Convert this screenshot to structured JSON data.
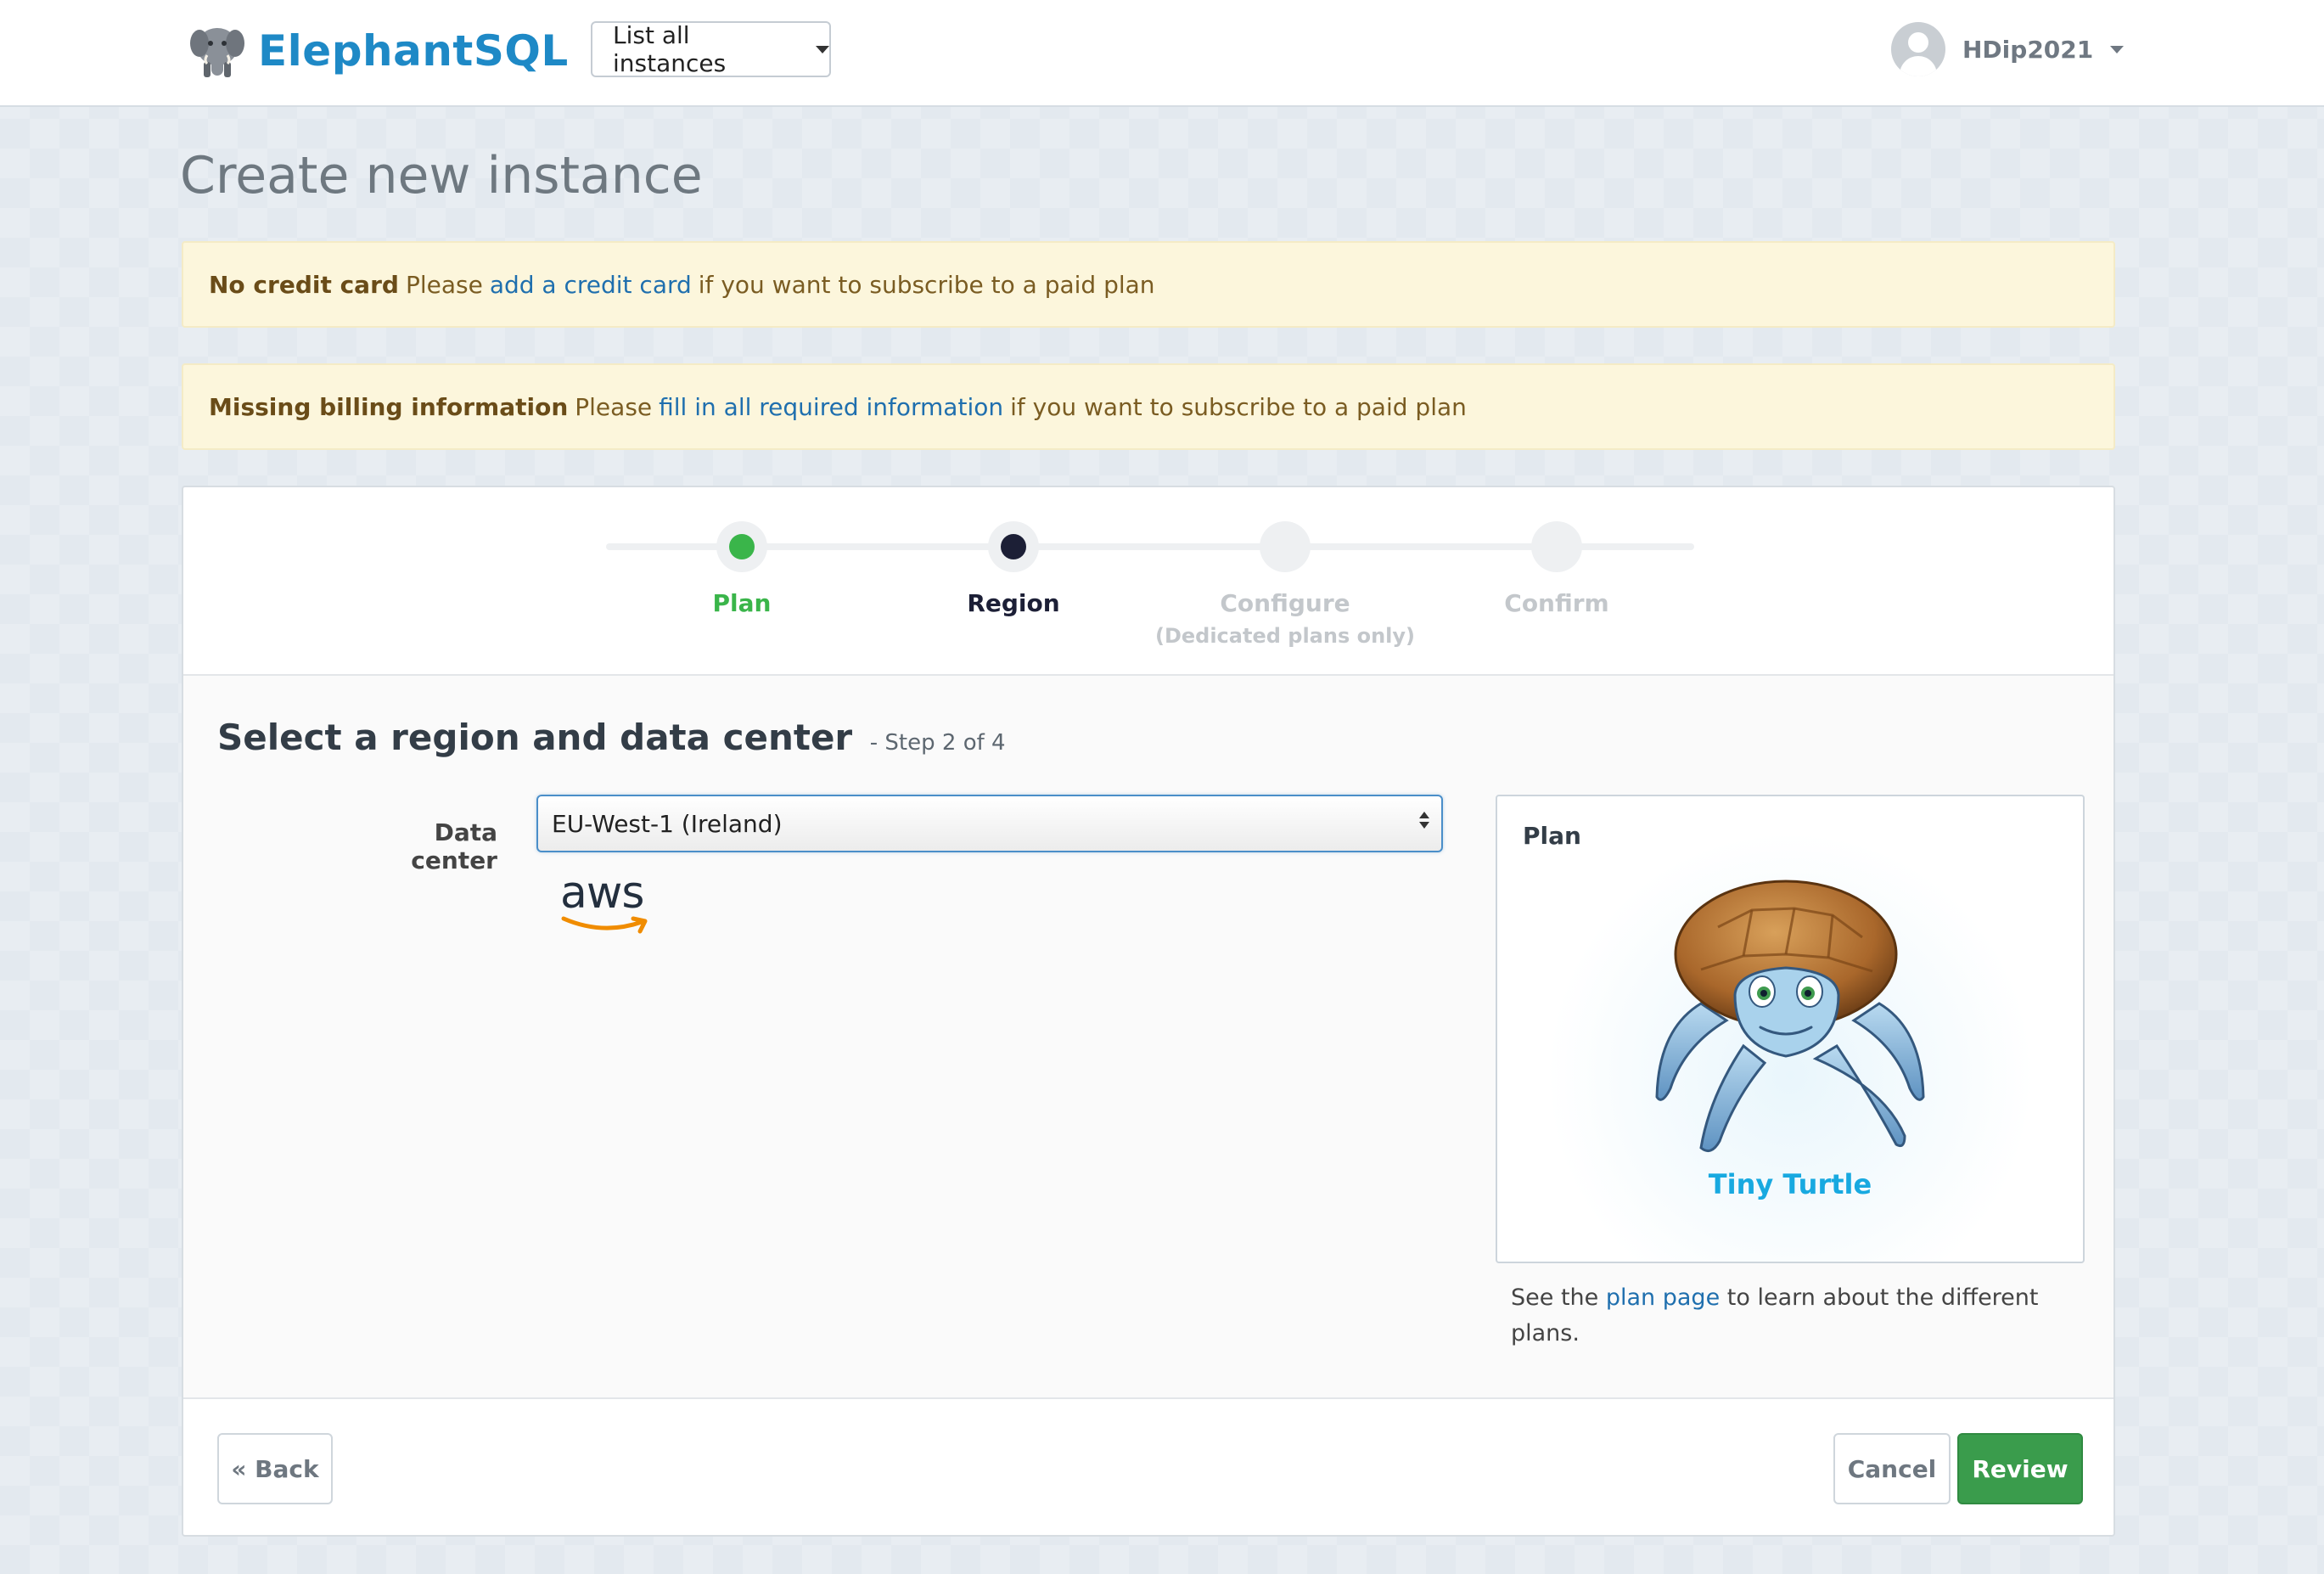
{
  "navbar": {
    "brand": "ElephantSQL",
    "instances_button": "List all instances",
    "username": "HDip2021"
  },
  "page": {
    "title": "Create new instance"
  },
  "alerts": [
    {
      "title": "No credit card",
      "before": "Please",
      "link": "add a credit card",
      "after": "if you want to subscribe to a paid plan"
    },
    {
      "title": "Missing billing information",
      "before": "Please",
      "link": "fill in all required information",
      "after": "if you want to subscribe to a paid plan"
    }
  ],
  "stepper": {
    "steps": [
      {
        "label": "Plan",
        "sub": "",
        "state": "done"
      },
      {
        "label": "Region",
        "sub": "",
        "state": "current"
      },
      {
        "label": "Configure",
        "sub": "(Dedicated plans only)",
        "state": "pending"
      },
      {
        "label": "Confirm",
        "sub": "",
        "state": "pending"
      }
    ]
  },
  "region": {
    "heading": "Select a region and data center",
    "step_count": "- Step 2 of 4",
    "data_center_label": "Data center",
    "data_center_value": "EU-West-1 (Ireland)",
    "provider_logo": "aws"
  },
  "plan": {
    "card_title": "Plan",
    "name": "Tiny Turtle",
    "note_before": "See the",
    "note_link": "plan page",
    "note_after": "to learn about the different plans."
  },
  "footer": {
    "back": "« Back",
    "cancel": "Cancel",
    "review": "Review"
  },
  "colors": {
    "brand": "#1e89c6",
    "done": "#3ab54a",
    "current": "#1c1f36",
    "review_button": "#3a9c4c",
    "plan_name": "#18a9e0"
  }
}
